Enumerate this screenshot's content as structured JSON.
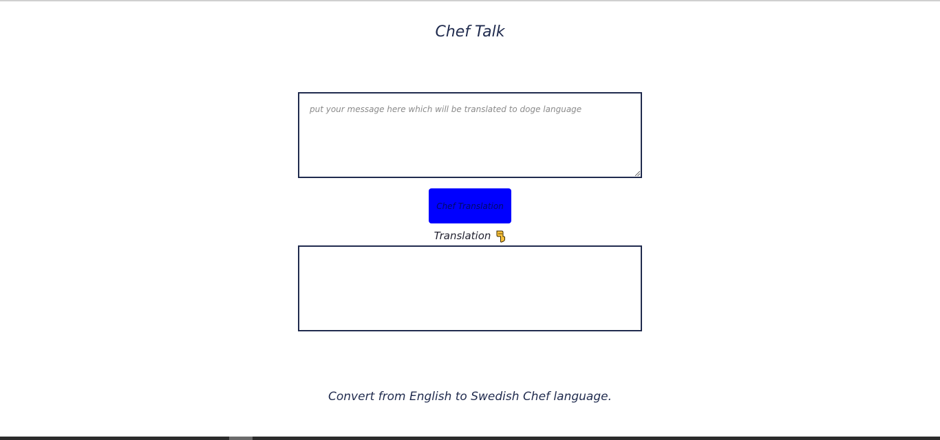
{
  "header": {
    "title": "Chef Talk"
  },
  "input": {
    "placeholder": "put your message here which will be translated to doge language",
    "value": ""
  },
  "button": {
    "label": "Chef Translation"
  },
  "output": {
    "label": "Translation",
    "label_icon": "pointing-down-hand-icon",
    "value": ""
  },
  "footer": {
    "text": "Convert from English to Swedish Chef language."
  },
  "colors": {
    "text": "#1f2a4d",
    "button_bg": "#0000ff",
    "border": "#1f2a4d"
  }
}
